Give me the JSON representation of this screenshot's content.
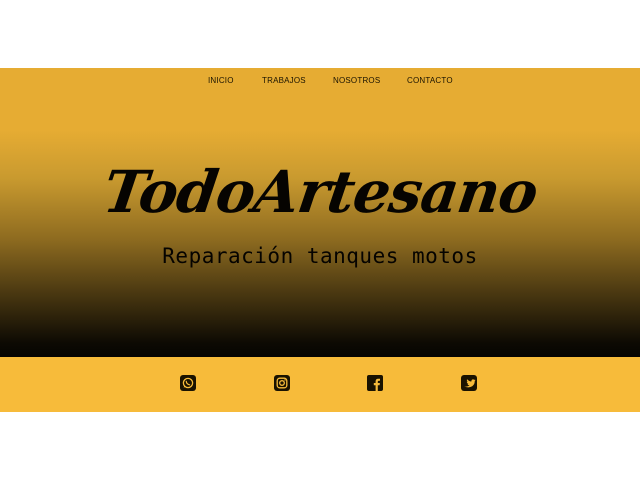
{
  "nav": {
    "items": [
      {
        "label": "INICIO"
      },
      {
        "label": "TRABAJOS"
      },
      {
        "label": "NOSOTROS"
      },
      {
        "label": "CONTACTO"
      }
    ]
  },
  "hero": {
    "title": "TodoArtesano",
    "tagline": "Reparación tanques motos"
  },
  "social": {
    "icons": [
      "whatsapp-icon",
      "instagram-icon",
      "facebook-icon",
      "twitter-icon"
    ]
  },
  "colors": {
    "accent": "#e6ac33",
    "footer_band": "#f7bb3a",
    "text_dark": "#060401"
  }
}
